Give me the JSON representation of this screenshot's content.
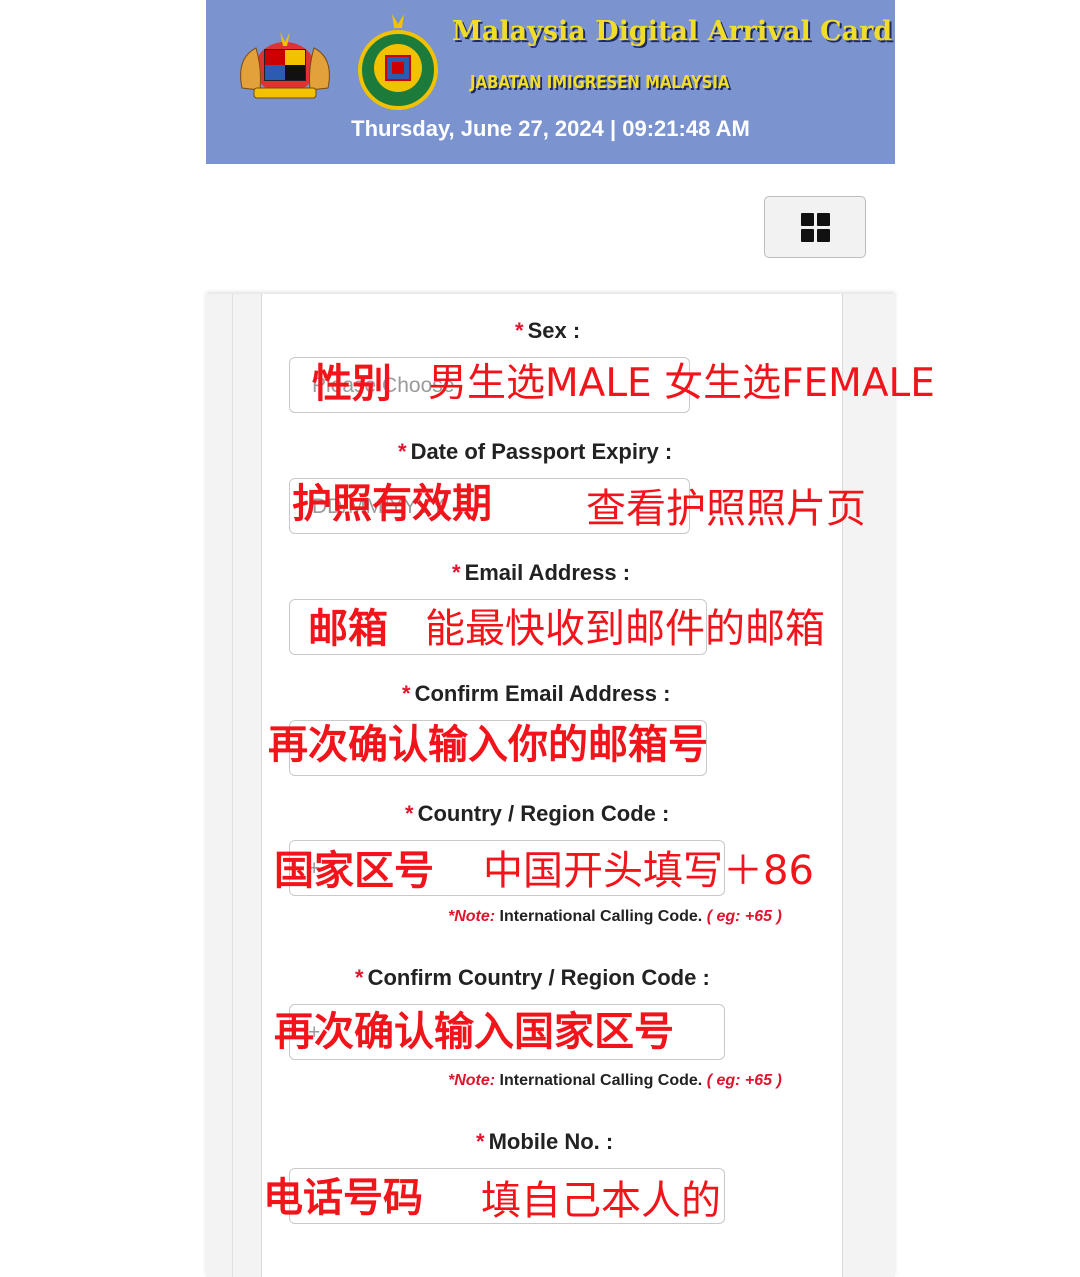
{
  "header": {
    "title": "Malaysia Digital Arrival Card",
    "subtitle": "JABATAN IMIGRESEN MALAYSIA",
    "datetime": "Thursday, June 27, 2024 | 09:21:48 AM"
  },
  "menu": {
    "icon": "grid-icon"
  },
  "form": {
    "required_mark": "*",
    "sex": {
      "label": "Sex :",
      "placeholder": "Please Choose"
    },
    "passport_expiry": {
      "label": "Date of Passport Expiry :",
      "placeholder": "DD/MM/YYYY"
    },
    "email": {
      "label": "Email Address :"
    },
    "confirm_email": {
      "label": "Confirm Email Address :"
    },
    "country_code": {
      "label": "Country / Region Code :",
      "placeholder": "+"
    },
    "confirm_country_code": {
      "label": "Confirm Country / Region Code :",
      "placeholder": "+"
    },
    "mobile": {
      "label": "Mobile No. :"
    },
    "note": {
      "prefix": "*Note:",
      "text": " International Calling Code. ",
      "example": "( eg: +65 )"
    }
  },
  "annotations": {
    "sex_bold": "性别",
    "sex_hint": "男生选MALE 女生选FEMALE",
    "passport_bold": "护照有效期",
    "passport_hint": "查看护照照片页",
    "email_bold": "邮箱",
    "email_hint": "能最快收到邮件的邮箱",
    "confirm_email_bold": "再次确认输入你的邮箱号",
    "country_bold": "国家区号",
    "country_hint": "中国开头填写＋86",
    "confirm_country_bold": "再次确认输入国家区号",
    "mobile_bold": "电话号码",
    "mobile_hint": "填自己本人的"
  },
  "colors": {
    "banner": "#7b93cf",
    "banner_title": "#f2dc2a",
    "required": "#e0142d",
    "annotation": "#f2141b"
  }
}
